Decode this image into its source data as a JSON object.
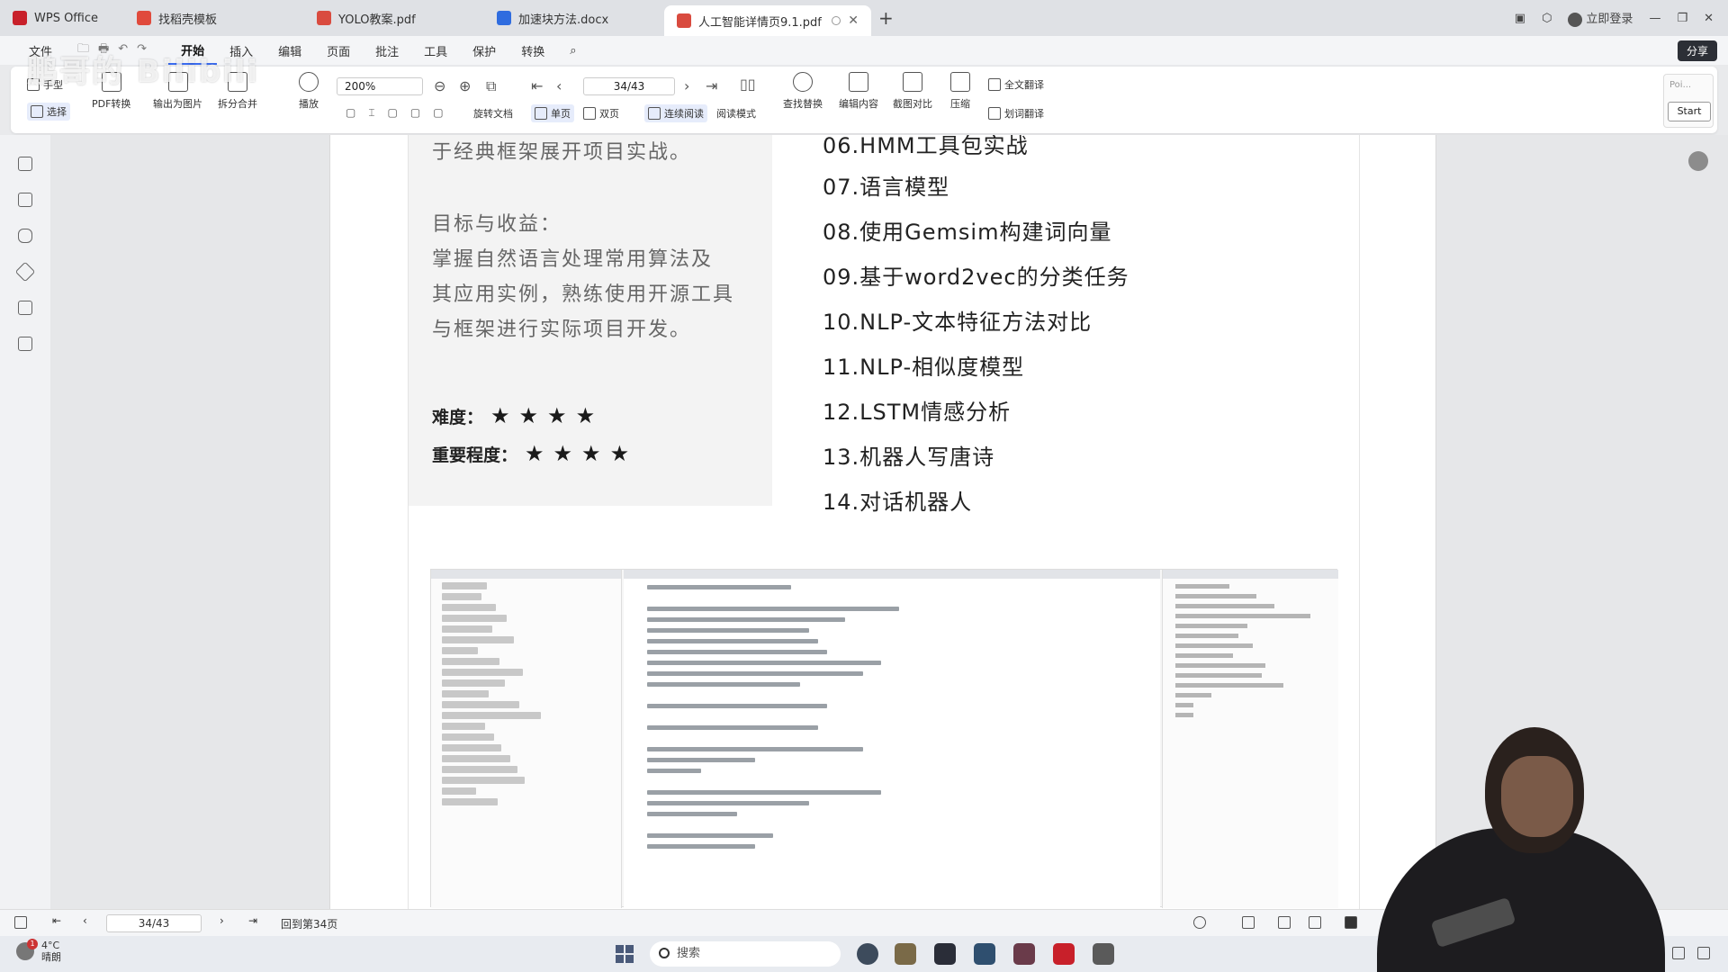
{
  "tabbar": {
    "tabs": [
      {
        "label": "WPS Office",
        "icon": "wps-logo-icon",
        "color": "#c8202a"
      },
      {
        "label": "找稻壳模板",
        "icon": "template-icon",
        "color": "#e04a3c"
      },
      {
        "label": "YOLO教案.pdf",
        "icon": "pdf-icon",
        "color": "#d94b3f"
      },
      {
        "label": "加速块方法.docx",
        "icon": "word-icon",
        "color": "#2f6cdf"
      },
      {
        "label": "人工智能详情页9.1.pdf",
        "icon": "pdf-icon",
        "color": "#d94b3f"
      }
    ],
    "login_label": "立即登录"
  },
  "menu": {
    "items": [
      "文件",
      "开始",
      "插入",
      "编辑",
      "页面",
      "批注",
      "工具",
      "保护",
      "转换"
    ],
    "active": "开始",
    "share_label": "分享"
  },
  "ribbon": {
    "hand_label": "手型",
    "select_label": "选择",
    "pdf_convert_label": "PDF转换",
    "export_image_label": "输出为图片",
    "split_merge_label": "拆分合并",
    "play_label": "播放",
    "zoom_value": "200%",
    "rotate_label": "旋转文档",
    "single_page_label": "单页",
    "double_page_label": "双页",
    "continuous_label": "连续阅读",
    "reading_mode_label": "阅读模式",
    "find_replace_label": "查找替换",
    "edit_content_label": "编辑内容",
    "screenshot_compare_label": "截图对比",
    "compress_label": "压缩",
    "full_translate_label": "全文翻译",
    "word_translate_label": "划词翻译",
    "page_value": "34/43",
    "start_card_label": "Poi...",
    "start_button_label": "Start"
  },
  "watermark": "鹏哥的 Bilibili",
  "document": {
    "left_panel": {
      "intro_tail": "于经典框架展开项目实战。",
      "goal_heading": "目标与收益：",
      "goal_lines": [
        "掌握自然语言处理常用算法及",
        "其应用实例，熟练使用开源工具",
        "与框架进行实际项目开发。"
      ],
      "difficulty_label": "难度：",
      "difficulty_stars": "★★★★",
      "difficulty_rating": 4,
      "importance_label": "重要程度：",
      "importance_stars": "★★★★",
      "importance_rating": 4
    },
    "toc": [
      "06.HMM工具包实战",
      "07.语言模型",
      "08.使用Gemsim构建词向量",
      "09.基于word2vec的分类任务",
      "10.NLP-文本特征方法对比",
      "11.NLP-相似度模型",
      "12.LSTM情感分析",
      "13.机器人写唐诗",
      "14.对话机器人"
    ]
  },
  "statusbar": {
    "page_value": "34/43",
    "page_text": "回到第34页"
  },
  "taskbar": {
    "temperature": "4°C",
    "weather_text": "晴朗",
    "notification_count": "1",
    "search_placeholder": "搜索"
  }
}
